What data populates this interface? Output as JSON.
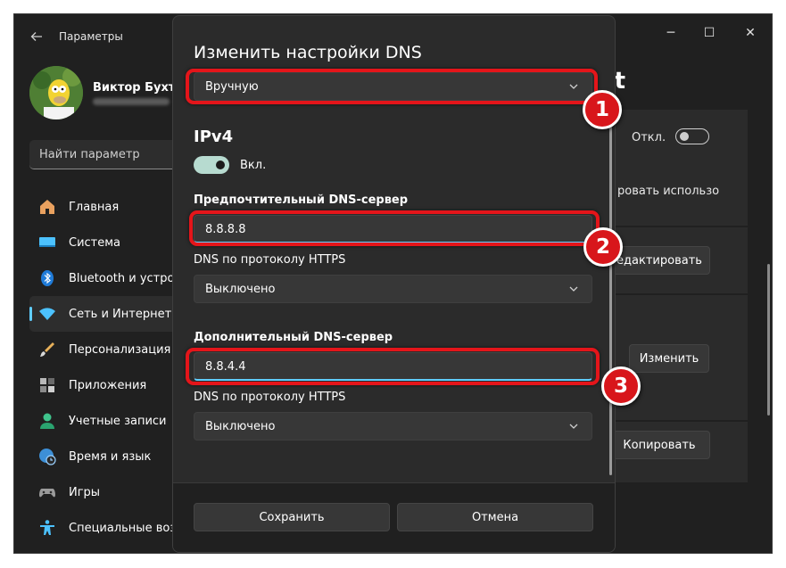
{
  "window": {
    "app_title": "Параметры",
    "controls": {
      "minimize": "─",
      "maximize": "☐",
      "close": "✕"
    }
  },
  "profile": {
    "name": "Виктор Бухте"
  },
  "search": {
    "placeholder": "Найти параметр"
  },
  "sidebar": {
    "items": [
      {
        "label": "Главная",
        "icon": "home-icon"
      },
      {
        "label": "Система",
        "icon": "system-icon"
      },
      {
        "label": "Bluetooth и устрой",
        "icon": "bluetooth-icon"
      },
      {
        "label": "Сеть и Интернет",
        "icon": "wifi-icon",
        "active": true
      },
      {
        "label": "Персонализация",
        "icon": "brush-icon"
      },
      {
        "label": "Приложения",
        "icon": "apps-icon"
      },
      {
        "label": "Учетные записи",
        "icon": "account-icon"
      },
      {
        "label": "Время и язык",
        "icon": "globe-clock-icon"
      },
      {
        "label": "Игры",
        "icon": "gamepad-icon"
      },
      {
        "label": "Специальные возм",
        "icon": "accessibility-icon"
      }
    ]
  },
  "background": {
    "title_fragment": "et",
    "toggle_label": "Откл.",
    "text_fragment": "ровать использо",
    "edit_button": "едактировать",
    "change_button": "Изменить",
    "copy_button": "Копировать"
  },
  "dialog": {
    "title": "Изменить настройки DNS",
    "mode_select": "Вручную",
    "ipv4_title": "IPv4",
    "ipv4_toggle_label": "Вкл.",
    "preferred_label": "Предпочтительный DNS-сервер",
    "preferred_value": "8.8.8.8",
    "https_label_1": "DNS по протоколу HTTPS",
    "https_value_1": "Выключено",
    "alternate_label": "Дополнительный DNS-сервер",
    "alternate_value": "8.8.4.4",
    "https_label_2": "DNS по протоколу HTTPS",
    "https_value_2": "Выключено",
    "save_button": "Сохранить",
    "cancel_button": "Отмена"
  },
  "annotations": [
    "1",
    "2",
    "3"
  ],
  "colors": {
    "annotation_red": "#e4151a",
    "accent": "#60cdff",
    "toggle_on": "#b7dbd0"
  }
}
